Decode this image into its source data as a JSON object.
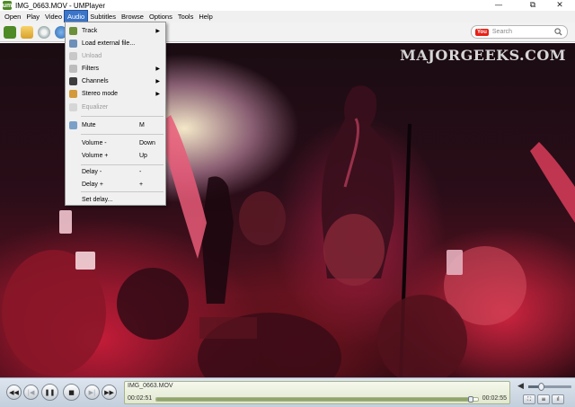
{
  "window": {
    "title": "IMG_0663.MOV - UMPlayer",
    "logo_text": "um",
    "minimize_glyph": "—",
    "maximize_glyph": "⧉",
    "close_glyph": "✕"
  },
  "menubar": {
    "items": [
      "Open",
      "Play",
      "Video",
      "Audio",
      "Subtitles",
      "Browse",
      "Options",
      "Tools",
      "Help"
    ],
    "active": "Audio"
  },
  "toolbar": {
    "youtube_logo_text": "You",
    "search_placeholder": "Search"
  },
  "video": {
    "watermark": "MAJORGEEKS.COM"
  },
  "audio_menu": {
    "items": [
      {
        "label": "Track",
        "submenu": true,
        "enabled": true,
        "icon": "music-note-icon"
      },
      {
        "label": "Load external file...",
        "enabled": true,
        "icon": "load-file-icon"
      },
      {
        "label": "Unload",
        "enabled": false,
        "icon": "unload-icon"
      },
      {
        "label": "Filters",
        "submenu": true,
        "enabled": true,
        "icon": "filter-icon"
      },
      {
        "label": "Channels",
        "submenu": true,
        "enabled": true,
        "icon": "channels-icon"
      },
      {
        "label": "Stereo mode",
        "submenu": true,
        "enabled": true,
        "icon": "speaker-icon"
      },
      {
        "label": "Equalizer",
        "enabled": false,
        "icon": "equalizer-icon"
      },
      {
        "label": "Mute",
        "shortcut": "M",
        "enabled": true,
        "icon": "mute-icon"
      },
      {
        "label": "Volume -",
        "shortcut": "Down",
        "enabled": true
      },
      {
        "label": "Volume +",
        "shortcut": "Up",
        "enabled": true
      },
      {
        "label": "Delay -",
        "shortcut": "-",
        "enabled": true
      },
      {
        "label": "Delay +",
        "shortcut": "+",
        "enabled": true
      },
      {
        "label": "Set delay...",
        "enabled": true
      }
    ],
    "submenu_arrow": "▶"
  },
  "controls": {
    "filename": "IMG_0663.MOV",
    "time_current": "00:02:51",
    "time_total": "00:02:55",
    "progress_fraction": 0.977,
    "volume_fraction": 0.3,
    "buttons": {
      "rewind": "◀◀",
      "prev": "|◀",
      "pause": "❚❚",
      "stop": "■",
      "next": "▶|",
      "forward": "▶▶",
      "fullscreen": "⛶",
      "playlist": "≡",
      "equalizer": "ıl"
    },
    "volume_glyph": "◀"
  },
  "colors": {
    "menu_highlight": "#3b75c9",
    "logo_green": "#4e8a25",
    "youtube_red": "#e62117"
  }
}
